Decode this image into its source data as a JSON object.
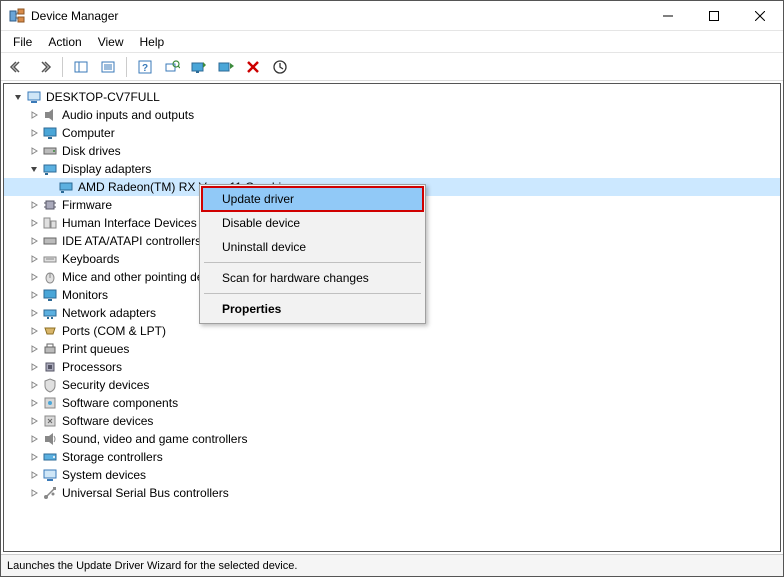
{
  "window": {
    "title": "Device Manager"
  },
  "menubar": {
    "file": "File",
    "action": "Action",
    "view": "View",
    "help": "Help"
  },
  "tree": {
    "root": "DESKTOP-CV7FULL",
    "categories": {
      "audio": "Audio inputs and outputs",
      "computer": "Computer",
      "disk": "Disk drives",
      "display": "Display adapters",
      "display_child": "AMD Radeon(TM) RX Vega 11 Graphics",
      "firmware": "Firmware",
      "hid": "Human Interface Devices",
      "ide": "IDE ATA/ATAPI controllers",
      "keyboards": "Keyboards",
      "mice": "Mice and other pointing devices",
      "monitors": "Monitors",
      "network": "Network adapters",
      "ports": "Ports (COM & LPT)",
      "print": "Print queues",
      "processors": "Processors",
      "security": "Security devices",
      "softcomp": "Software components",
      "softdev": "Software devices",
      "sound": "Sound, video and game controllers",
      "storage": "Storage controllers",
      "system": "System devices",
      "usb": "Universal Serial Bus controllers"
    }
  },
  "context_menu": {
    "update": "Update driver",
    "disable": "Disable device",
    "uninstall": "Uninstall device",
    "scan": "Scan for hardware changes",
    "properties": "Properties"
  },
  "statusbar": {
    "text": "Launches the Update Driver Wizard for the selected device."
  },
  "icons": {
    "app": "device-manager-icon"
  }
}
